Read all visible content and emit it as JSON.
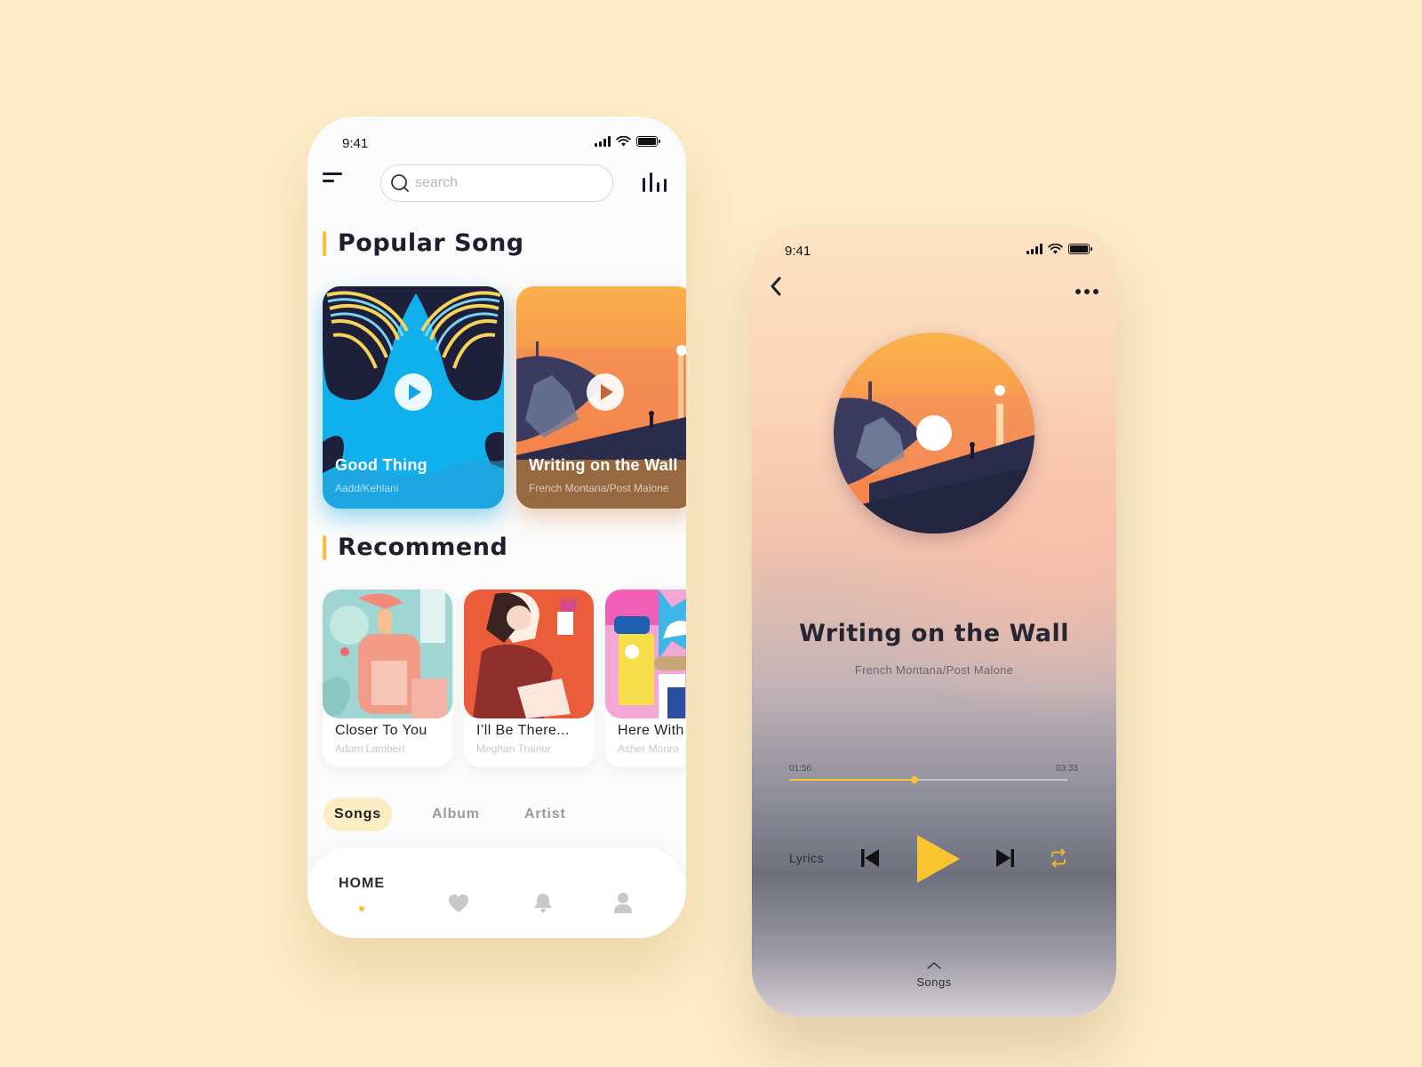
{
  "home_screen": {
    "status_bar": {
      "time": "9:41"
    },
    "search": {
      "placeholder": "search"
    },
    "popular": {
      "title": "Popular Song",
      "cards": [
        {
          "title": "Good Thing",
          "artist": "Aadd/Kehlani"
        },
        {
          "title": "Writing on the Wall",
          "artist": "French Montana/Post Malone"
        }
      ]
    },
    "recommend": {
      "title": "Recommend",
      "cards": [
        {
          "title": "Closer To You",
          "artist": "Adam Lambert"
        },
        {
          "title": "I’ll Be There...",
          "artist": "Meghan Trainor"
        },
        {
          "title": "Here With",
          "artist": "Asher Monro"
        }
      ]
    },
    "tabs": [
      "Songs",
      "Album",
      "Artist"
    ],
    "active_tab": "Songs",
    "bottom_nav": {
      "home_label": "HOME",
      "icons": [
        "heart-icon",
        "bell-icon",
        "user-icon"
      ]
    }
  },
  "player_screen": {
    "status_bar": {
      "time": "9:41"
    },
    "song": {
      "title": "Writing on the Wall",
      "artist": "French Montana/Post Malone"
    },
    "progress": {
      "current": "01:56",
      "total": "03:33",
      "fraction": 0.45
    },
    "controls": {
      "lyrics_label": "Lyrics"
    },
    "drawer_label": "Songs"
  },
  "colors": {
    "accent": "#f7c236",
    "background": "#fdecc8",
    "text_dark": "#1e1e2f"
  }
}
